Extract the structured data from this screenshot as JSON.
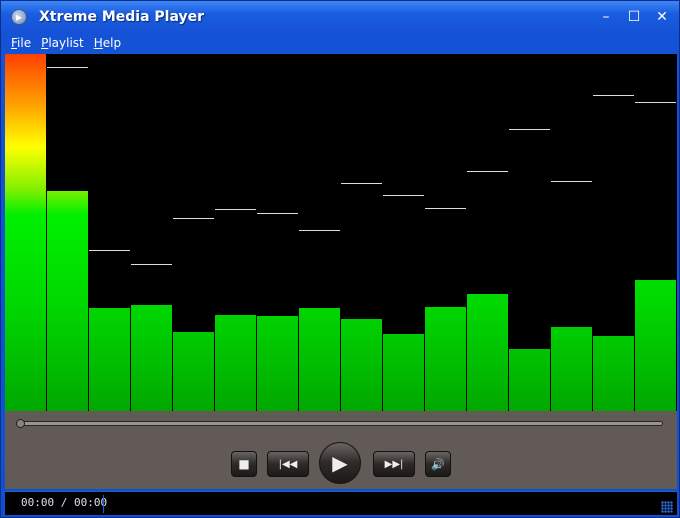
{
  "window": {
    "title": "Xtreme Media Player",
    "minimize": "–",
    "maximize": "☐",
    "close": "✕"
  },
  "menu": [
    "File",
    "Playlist",
    "Help"
  ],
  "visualizer": {
    "levels": [
      1.0,
      0.616,
      0.289,
      0.297,
      0.221,
      0.269,
      0.266,
      0.289,
      0.258,
      0.216,
      0.291,
      0.328,
      0.174,
      0.235,
      0.21,
      0.367
    ],
    "peaks": [
      1.0,
      0.964,
      0.451,
      0.412,
      0.541,
      0.566,
      0.555,
      0.507,
      0.639,
      0.605,
      0.569,
      0.672,
      0.79,
      0.644,
      0.885,
      0.866
    ]
  },
  "seek": {
    "progress": 0
  },
  "buttons": {
    "stop": "■",
    "prev": "|◀◀",
    "play": "▶",
    "next": "▶▶|",
    "volume": "🔊"
  },
  "status": {
    "time": "00:00 / 00:00"
  }
}
